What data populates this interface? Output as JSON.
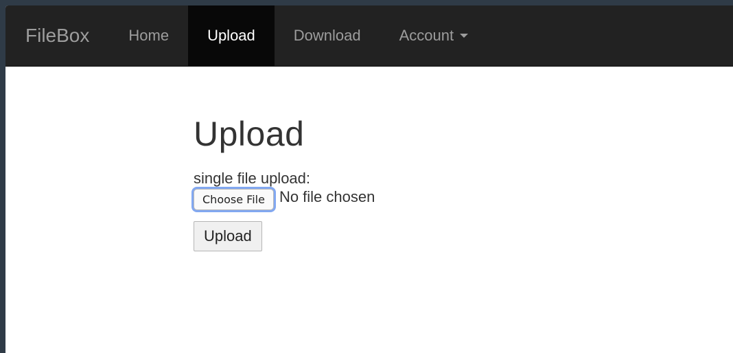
{
  "navbar": {
    "brand": "FileBox",
    "items": [
      {
        "label": "Home",
        "active": false
      },
      {
        "label": "Upload",
        "active": true
      },
      {
        "label": "Download",
        "active": false
      },
      {
        "label": "Account",
        "active": false,
        "has_caret": true
      }
    ]
  },
  "main": {
    "title": "Upload",
    "field_label": "single file upload:",
    "file_input": {
      "button_label": "Choose File",
      "status_text": "No file chosen"
    },
    "submit_label": "Upload"
  },
  "colors": {
    "navbar_bg": "#222222",
    "navbar_active_bg": "#080808",
    "nav_text": "#9d9d9d",
    "nav_text_active": "#ffffff",
    "focus_ring": "#82a8f1",
    "page_bg": "#2f3b47"
  },
  "icons": {
    "account_dropdown": "caret-down-icon"
  }
}
